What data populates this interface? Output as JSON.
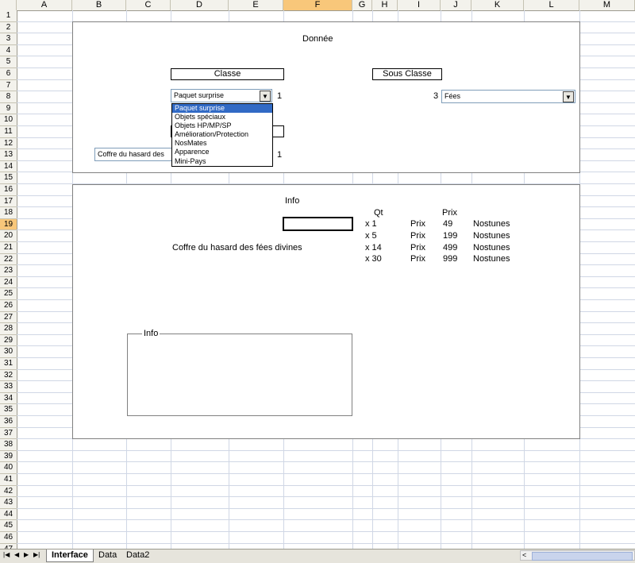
{
  "columns": [
    "A",
    "B",
    "C",
    "D",
    "E",
    "F",
    "G",
    "H",
    "I",
    "J",
    "K",
    "L",
    "M"
  ],
  "selected_column": "F",
  "rows": [
    "1",
    "2",
    "3",
    "4",
    "5",
    "6",
    "7",
    "8",
    "9",
    "10",
    "11",
    "12",
    "13",
    "14",
    "15",
    "16",
    "17",
    "18",
    "19",
    "20",
    "21",
    "22",
    "23",
    "24",
    "25",
    "26",
    "27",
    "28",
    "29",
    "30",
    "31",
    "32",
    "33",
    "34",
    "35",
    "36",
    "37",
    "38",
    "39",
    "40",
    "41",
    "42",
    "43",
    "44",
    "45",
    "46",
    "47"
  ],
  "selected_row": "19",
  "donnee": {
    "title": "Donnée",
    "classe_label": "Classe",
    "sous_classe_label": "Sous Classe",
    "classe_combo_value": "Paquet surprise",
    "classe_index": "1",
    "sous_classe_index": "3",
    "sous_classe_combo_value": "Fées",
    "item_combo_value": "Coffre du hasard des",
    "item_index": "1",
    "dropdown_options": [
      "Paquet surprise",
      "Objets spéciaux",
      "Objets HP/MP/SP",
      "Amélioration/Protection",
      "NosMates",
      "Apparence",
      "Mini-Pays"
    ],
    "dropdown_selected": "Paquet surprise"
  },
  "info": {
    "title": "Info",
    "item_name": "Coffre du hasard des fées divines",
    "qt_header": "Qt",
    "prix_header": "Prix",
    "rows": [
      {
        "qty": "x 1",
        "prix_label": "Prix",
        "price": "49",
        "currency": "Nostunes"
      },
      {
        "qty": "x 5",
        "prix_label": "Prix",
        "price": "199",
        "currency": "Nostunes"
      },
      {
        "qty": "x 14",
        "prix_label": "Prix",
        "price": "499",
        "currency": "Nostunes"
      },
      {
        "qty": "x 30",
        "prix_label": "Prix",
        "price": "999",
        "currency": "Nostunes"
      }
    ],
    "info_box_legend": "Info"
  },
  "sheet_tabs": [
    "Interface",
    "Data",
    "Data2"
  ],
  "active_tab": "Interface"
}
